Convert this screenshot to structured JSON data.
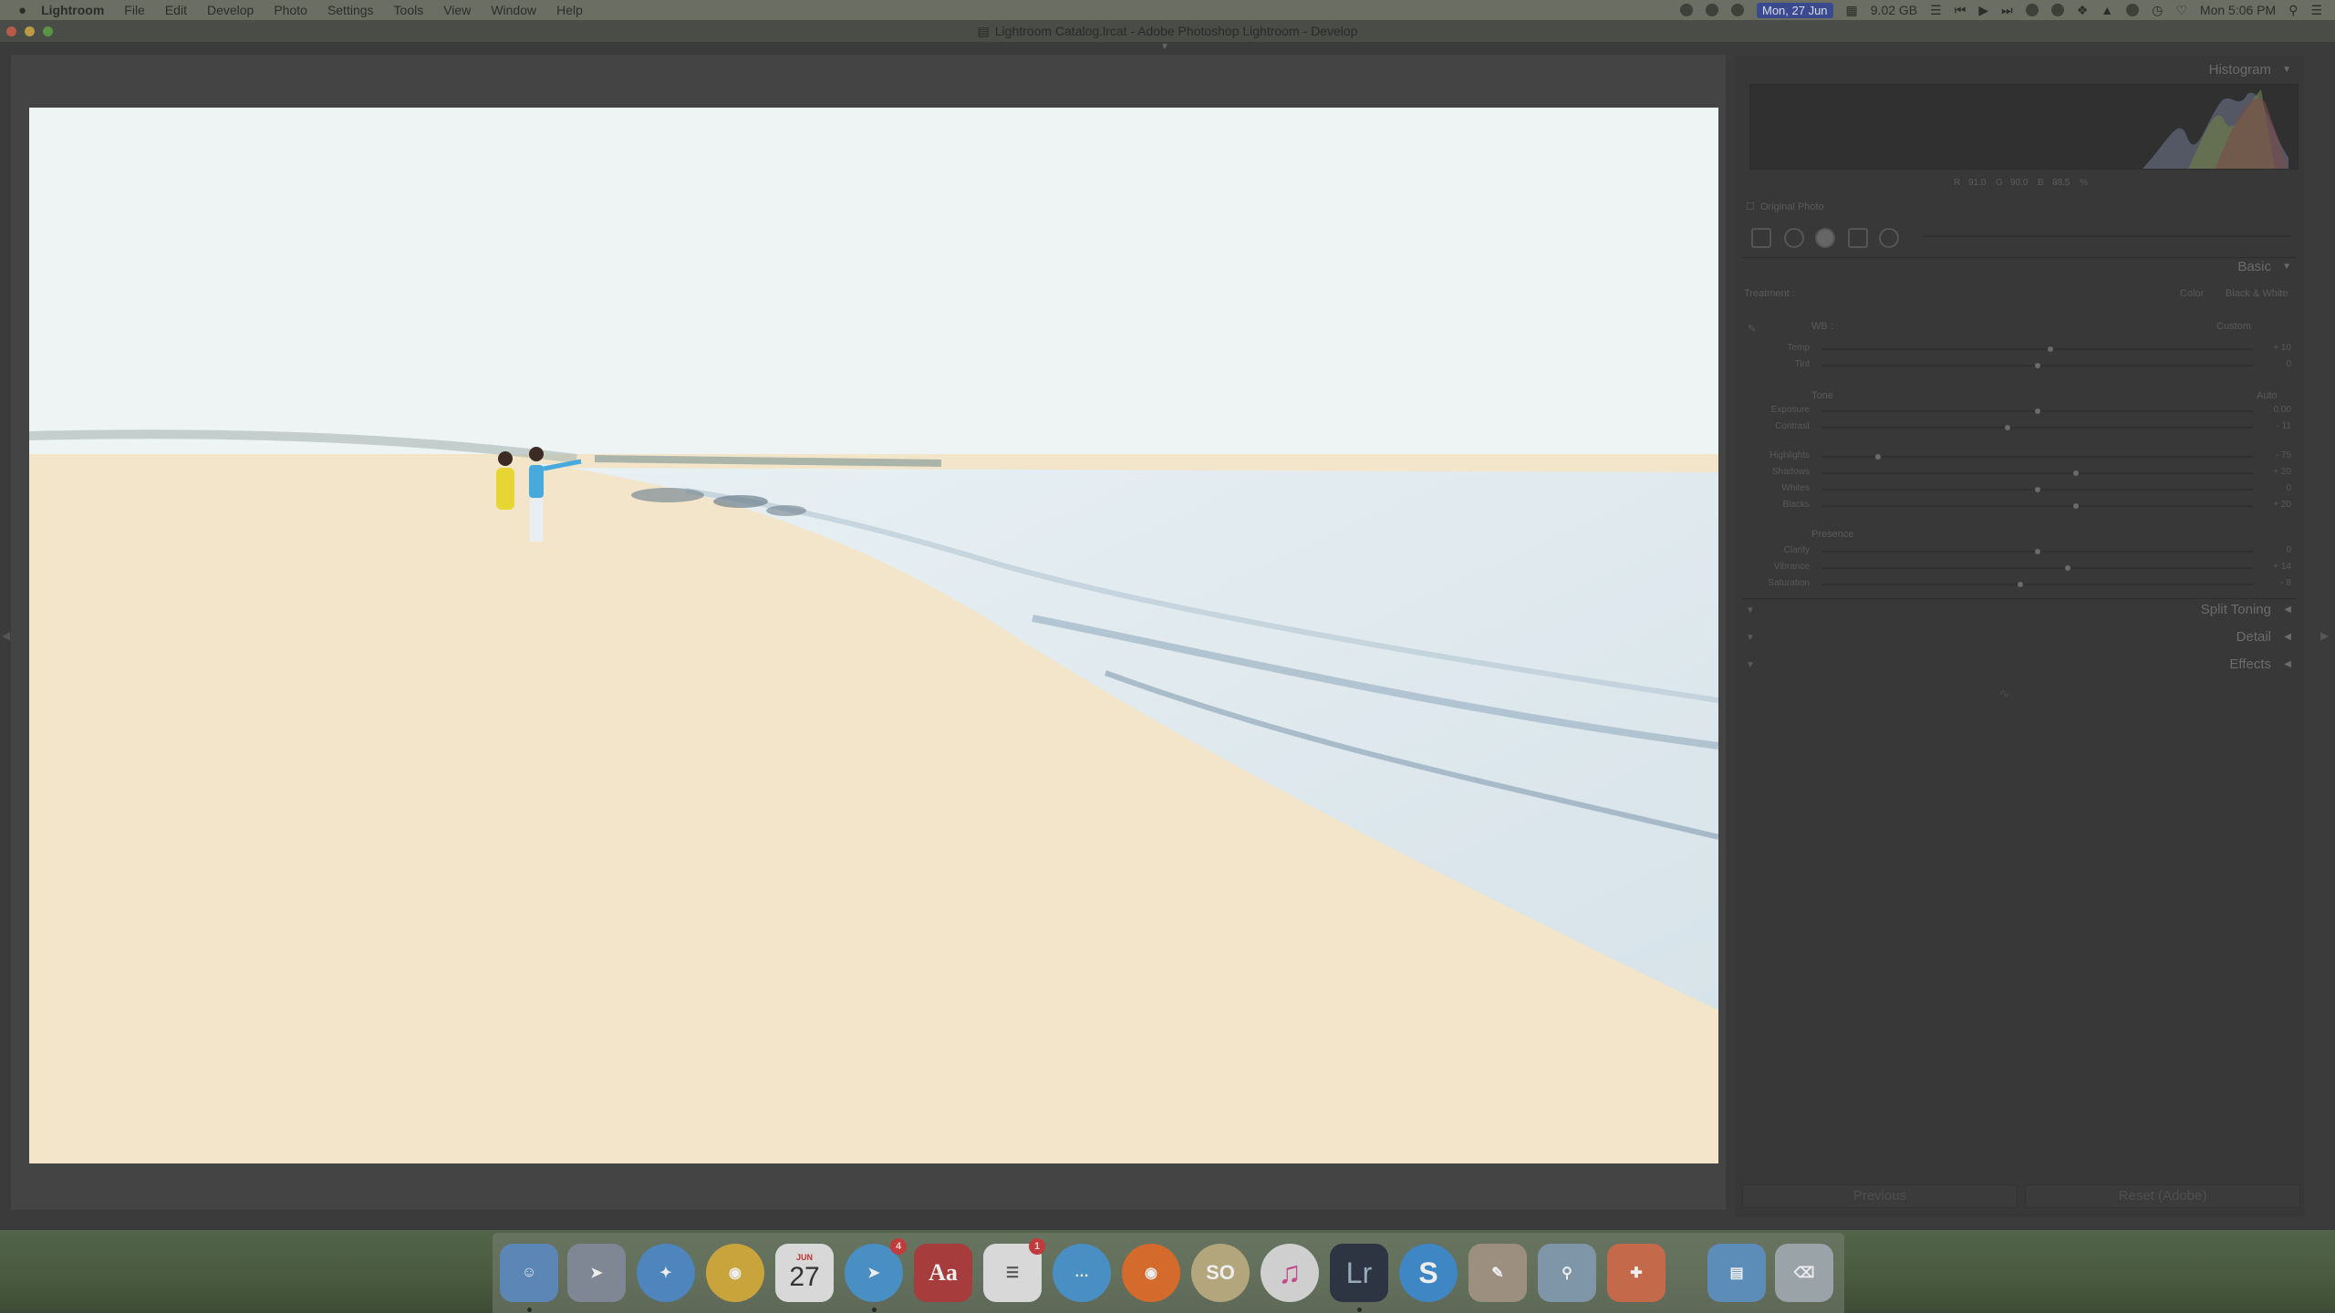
{
  "menubar": {
    "apple": "",
    "app": "Lightroom",
    "items": [
      "File",
      "Edit",
      "Develop",
      "Photo",
      "Settings",
      "Tools",
      "View",
      "Window",
      "Help"
    ],
    "date_badge": "Mon, 27 Jun",
    "memory": "9.02 GB",
    "clock": "Mon 5:06 PM"
  },
  "window": {
    "title": "Lightroom Catalog.lrcat - Adobe Photoshop Lightroom - Develop"
  },
  "panel": {
    "histogram_title": "Histogram",
    "histogram_values": {
      "r_label": "R",
      "r": "91.0",
      "g_label": "G",
      "g": "90.0",
      "b_label": "B",
      "b": "88.5",
      "unit": "%"
    },
    "original_photo": "Original Photo",
    "basic_title": "Basic",
    "treatment_label": "Treatment :",
    "treatment_color": "Color",
    "treatment_bw": "Black & White",
    "wb_label": "WB :",
    "wb_value": "Custom",
    "tone_label": "Tone",
    "tone_auto": "Auto",
    "presence_label": "Presence",
    "sliders": [
      {
        "label": "Temp",
        "value": "+ 10",
        "pos": 0.53
      },
      {
        "label": "Tint",
        "value": "0",
        "pos": 0.5
      },
      {
        "label": "Exposure",
        "value": "0.00",
        "pos": 0.5
      },
      {
        "label": "Contrast",
        "value": "- 11",
        "pos": 0.43
      },
      {
        "label": "Highlights",
        "value": "- 75",
        "pos": 0.13
      },
      {
        "label": "Shadows",
        "value": "+ 20",
        "pos": 0.59
      },
      {
        "label": "Whites",
        "value": "0",
        "pos": 0.5
      },
      {
        "label": "Blacks",
        "value": "+ 20",
        "pos": 0.59
      },
      {
        "label": "Clarity",
        "value": "0",
        "pos": 0.5
      },
      {
        "label": "Vibrance",
        "value": "+ 14",
        "pos": 0.57
      },
      {
        "label": "Saturation",
        "value": "- 8",
        "pos": 0.46
      }
    ],
    "split_toning": "Split Toning",
    "detail": "Detail",
    "effects": "Effects",
    "previous_button": "Previous",
    "reset_button": "Reset (Adobe)"
  },
  "dock": {
    "calendar_day": "27",
    "calendar_month": "JUN",
    "telegram_badge": "4",
    "reminders_badge": "1",
    "dictionary_label": "Aa",
    "lightroom_label": "Lr",
    "so_label": "SO"
  },
  "colors": {
    "menubar": "#6a6e63",
    "panel": "#383838",
    "workspace": "#3b3b3b",
    "accent_badge": "#3b4a8f"
  }
}
